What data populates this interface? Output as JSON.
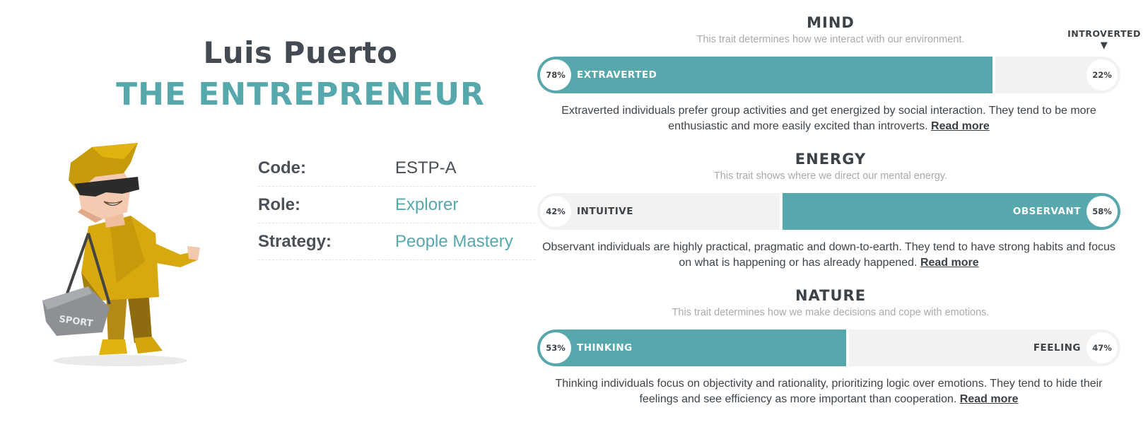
{
  "profile": {
    "name": "Luis Puerto",
    "type": "THE ENTREPRENEUR"
  },
  "info": [
    {
      "key": "Code:",
      "value": "ESTP-A"
    },
    {
      "key": "Role:",
      "value": "Explorer"
    },
    {
      "key": "Strategy:",
      "value": "People Mastery"
    }
  ],
  "hint": {
    "label": "INTROVERTED",
    "arrow": "▼"
  },
  "traits": [
    {
      "title": "MIND",
      "subtitle": "This trait determines how we interact with our environment.",
      "left_label": "EXTRAVERTED",
      "left_pct": "78%",
      "right_label": "",
      "right_pct": "22%",
      "dominant": "left",
      "description": "Extraverted individuals prefer group activities and get energized by social interaction. They tend to be more enthusiastic and more easily excited than introverts.",
      "link": "Read more"
    },
    {
      "title": "ENERGY",
      "subtitle": "This trait shows where we direct our mental energy.",
      "left_label": "INTUITIVE",
      "left_pct": "42%",
      "right_label": "OBSERVANT",
      "right_pct": "58%",
      "dominant": "right",
      "description": "Observant individuals are highly practical, pragmatic and down-to-earth. They tend to have strong habits and focus on what is happening or has already happened.",
      "link": "Read more"
    },
    {
      "title": "NATURE",
      "subtitle": "This trait determines how we make decisions and cope with emotions.",
      "left_label": "THINKING",
      "left_pct": "53%",
      "right_label": "FEELING",
      "right_pct": "47%",
      "dominant": "left",
      "description": "Thinking individuals focus on objectivity and rationality, prioritizing logic over emotions. They tend to hide their feelings and see efficiency as more important than cooperation.",
      "link": "Read more"
    }
  ],
  "colors": {
    "accent": "#56a8ad",
    "track": "#f2f2f2",
    "text": "#3d4247"
  },
  "icons": {
    "avatar": "entrepreneur-avatar-illustration",
    "bag_text": "SPORT"
  }
}
